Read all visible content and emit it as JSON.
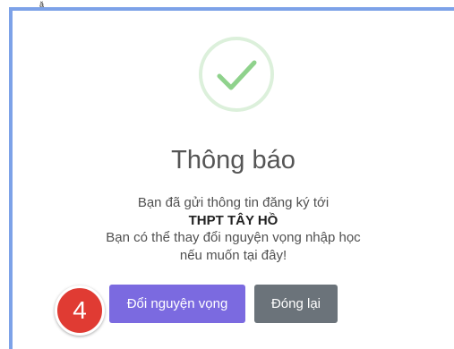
{
  "corner_mark": "ặ",
  "dialog": {
    "icon": "check-circle-icon",
    "title": "Thông báo",
    "message_line1": "Bạn đã gửi thông tin đăng ký tới",
    "school_name": "THPT TÂY HỒ",
    "message_line3": "Bạn có thể thay đổi nguyện vọng nhập học",
    "message_line4": "nếu muốn tại đây!"
  },
  "step_badge": "4",
  "buttons": {
    "change_label": "Đổi nguyện vọng",
    "close_label": "Đóng lại"
  },
  "colors": {
    "frame_border": "#7da2e8",
    "success_green": "#8fd28c",
    "primary_button": "#7b6ae0",
    "secondary_button": "#6b737a",
    "badge_red": "#e03b33"
  }
}
